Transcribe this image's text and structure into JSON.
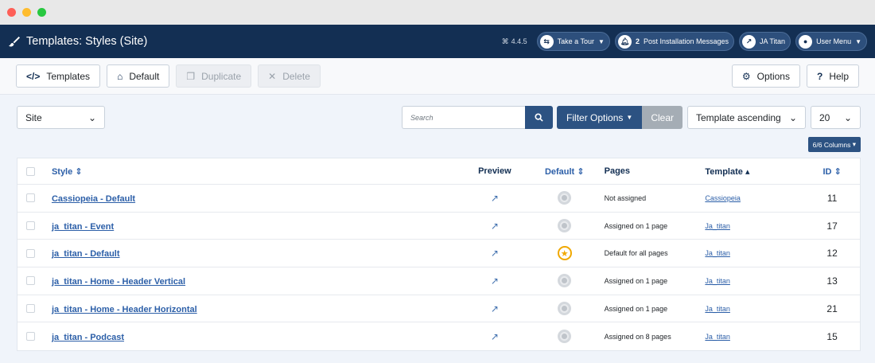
{
  "header": {
    "title": "Templates: Styles (Site)",
    "version": "4.4.5",
    "take_tour": "Take a Tour",
    "post_install_count": "2",
    "post_install": "Post Installation Messages",
    "site_name": "JA Titan",
    "user_menu": "User Menu"
  },
  "toolbar": {
    "templates": "Templates",
    "default": "Default",
    "duplicate": "Duplicate",
    "delete": "Delete",
    "options": "Options",
    "help": "Help"
  },
  "filters": {
    "client": "Site",
    "search_placeholder": "Search",
    "filter_options": "Filter Options",
    "clear": "Clear",
    "sort": "Template ascending",
    "limit": "20",
    "columns": "6/6 Columns"
  },
  "table": {
    "headers": {
      "style": "Style",
      "preview": "Preview",
      "default": "Default",
      "pages": "Pages",
      "template": "Template",
      "id": "ID"
    },
    "rows": [
      {
        "style": "Cassiopeia - Default",
        "pages": "Not assigned",
        "template": "Cassiopeia",
        "id": "11",
        "is_default": false
      },
      {
        "style": "ja_titan - Event",
        "pages": "Assigned on 1 page",
        "template": "Ja_titan",
        "id": "17",
        "is_default": false
      },
      {
        "style": "ja_titan - Default",
        "pages": "Default for all pages",
        "template": "Ja_titan",
        "id": "12",
        "is_default": true
      },
      {
        "style": "ja_titan - Home - Header Vertical",
        "pages": "Assigned on 1 page",
        "template": "Ja_titan",
        "id": "13",
        "is_default": false
      },
      {
        "style": "ja_titan - Home - Header Horizontal",
        "pages": "Assigned on 1 page",
        "template": "Ja_titan",
        "id": "21",
        "is_default": false
      },
      {
        "style": "ja_titan - Podcast",
        "pages": "Assigned on 8 pages",
        "template": "Ja_titan",
        "id": "15",
        "is_default": false
      }
    ]
  },
  "colors": {
    "header_bg": "#132f53",
    "accent": "#2c5282",
    "link": "#2c5fa8",
    "star": "#f0a800",
    "window_red": "#fe5f57",
    "window_yellow": "#febc2e",
    "window_green": "#28c840"
  }
}
